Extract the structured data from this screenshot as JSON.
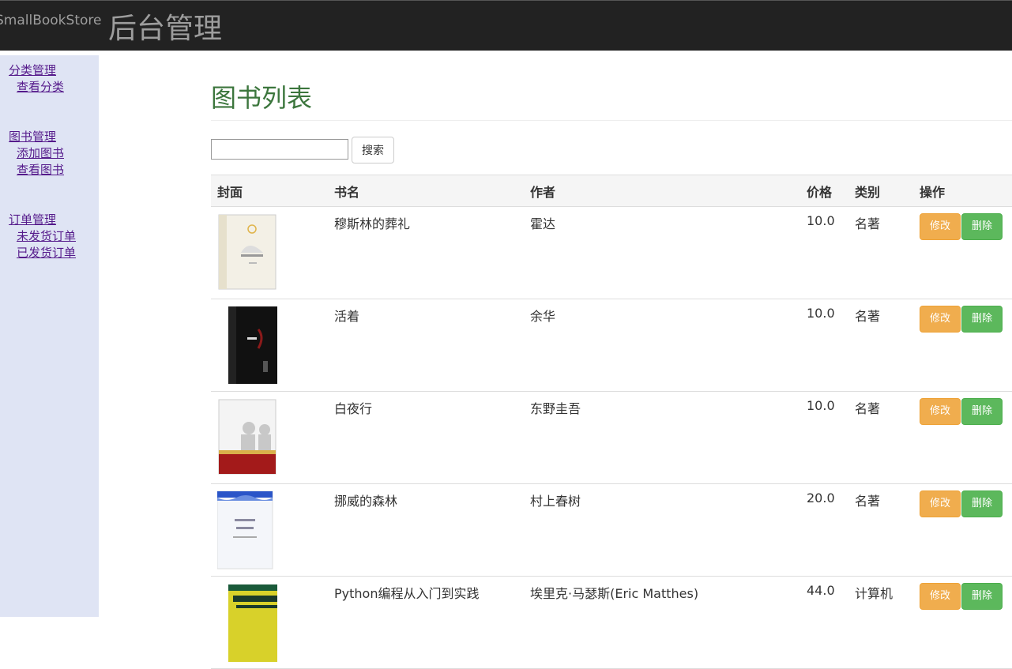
{
  "navbar": {
    "brand": "SmallBookStore",
    "title": "后台管理"
  },
  "sidebar": {
    "groups": [
      {
        "label": "分类管理",
        "items": [
          "查看分类"
        ]
      },
      {
        "label": "图书管理",
        "items": [
          "添加图书",
          "查看图书"
        ]
      },
      {
        "label": "订单管理",
        "items": [
          "未发货订单",
          "已发货订单"
        ]
      }
    ]
  },
  "main": {
    "title": "图书列表",
    "search": {
      "value": "",
      "placeholder": "",
      "button_label": "搜索"
    },
    "table": {
      "headers": {
        "cover": "封面",
        "name": "书名",
        "author": "作者",
        "price": "价格",
        "category": "类别",
        "actions": "操作"
      },
      "edit_label": "修改",
      "delete_label": "删除",
      "rows": [
        {
          "name": "穆斯林的葬礼",
          "author": "霍达",
          "price": "10.0",
          "category": "名著",
          "cover_icon": "book-cover-image"
        },
        {
          "name": "活着",
          "author": "余华",
          "price": "10.0",
          "category": "名著",
          "cover_icon": "book-cover-image"
        },
        {
          "name": "白夜行",
          "author": "东野圭吾",
          "price": "10.0",
          "category": "名著",
          "cover_icon": "book-cover-image"
        },
        {
          "name": "挪威的森林",
          "author": "村上春树",
          "price": "20.0",
          "category": "名著",
          "cover_icon": "book-cover-image"
        },
        {
          "name": "Python编程从入门到实践",
          "author": "埃里克·马瑟斯(Eric Matthes)",
          "price": "44.0",
          "category": "计算机",
          "cover_icon": "book-cover-image"
        }
      ]
    }
  }
}
